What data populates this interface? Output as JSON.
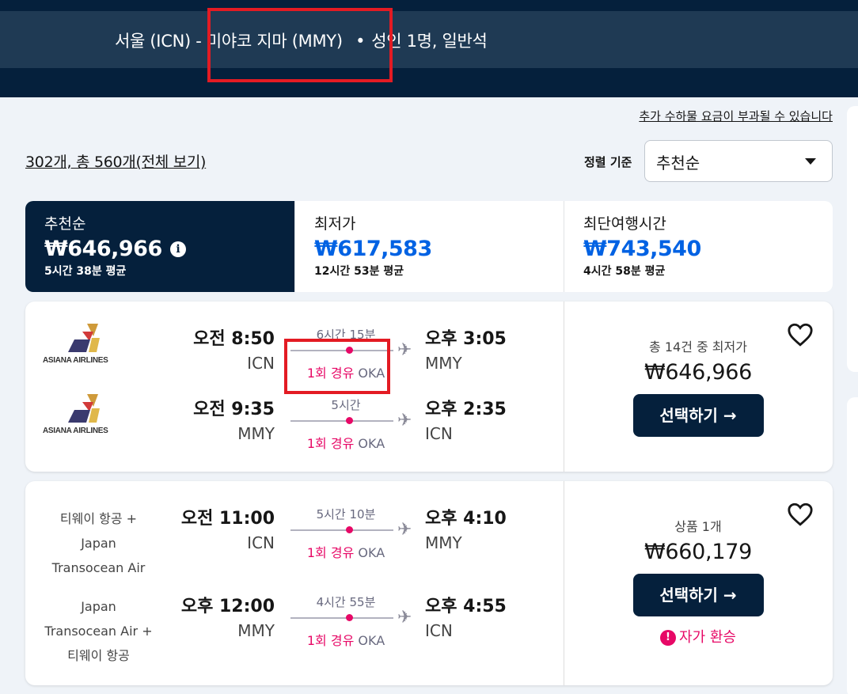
{
  "header": {
    "route_prefix": "서울 (ICN) - ",
    "destination": "미야코 지마 (MMY)",
    "separator": "•",
    "passengers": "성인 1명, 일반석"
  },
  "baggage_notice": "추가 수하물 요금이 부과될 수 있습니다",
  "results_summary": "302개, 총 560개(전체 보기)",
  "sort": {
    "label": "정렬 기준",
    "selected": "추천순"
  },
  "tabs": [
    {
      "label": "추천순",
      "price": "₩646,966",
      "sub": "5시간 38분 평균",
      "info_icon": "info-icon"
    },
    {
      "label": "최저가",
      "price": "₩617,583",
      "sub": "12시간 53분 평균"
    },
    {
      "label": "최단여행시간",
      "price": "₩743,540",
      "sub": "4시간 58분 평균"
    }
  ],
  "results": [
    {
      "legs": [
        {
          "airline_logo": "ASIANA AIRLINES",
          "dep_time": "오전 8:50",
          "dep_code": "ICN",
          "duration": "6시간 15분",
          "stops": "1회 경유",
          "stop_code": "OKA",
          "arr_time": "오후 3:05",
          "arr_code": "MMY"
        },
        {
          "airline_logo": "ASIANA AIRLINES",
          "dep_time": "오전 9:35",
          "dep_code": "MMY",
          "duration": "5시간",
          "stops": "1회 경유",
          "stop_code": "OKA",
          "arr_time": "오후 2:35",
          "arr_code": "ICN"
        }
      ],
      "price_note": "총 14건 중 최저가",
      "price": "₩646,966",
      "select_label": "선택하기 →"
    },
    {
      "legs": [
        {
          "airline_lines": [
            "티웨이 항공 +",
            "Japan",
            "Transocean Air"
          ],
          "dep_time": "오전 11:00",
          "dep_code": "ICN",
          "duration": "5시간 10분",
          "stops": "1회 경유",
          "stop_code": "OKA",
          "arr_time": "오후 4:10",
          "arr_code": "MMY"
        },
        {
          "airline_lines": [
            "Japan",
            "Transocean Air +",
            "티웨이 항공"
          ],
          "dep_time": "오후 12:00",
          "dep_code": "MMY",
          "duration": "4시간 55분",
          "stops": "1회 경유",
          "stop_code": "OKA",
          "arr_time": "오후 4:55",
          "arr_code": "ICN"
        }
      ],
      "price_note": "상품 1개",
      "price": "₩660,179",
      "select_label": "선택하기 →",
      "warning": "자가 환승"
    }
  ],
  "colors": {
    "header_bg": "#05203c",
    "accent_pink": "#e70866",
    "price_blue": "#0062e3",
    "highlight_red": "#e31b23"
  }
}
